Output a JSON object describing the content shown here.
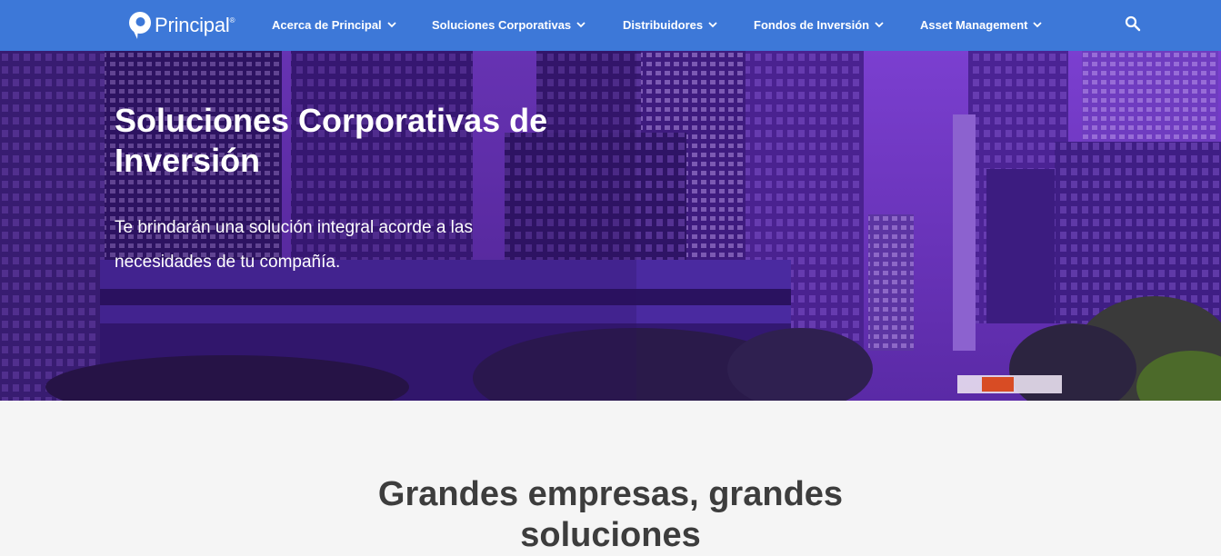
{
  "header": {
    "brand": "Principal",
    "brand_mark": "®",
    "nav": [
      {
        "label": "Acerca de Principal"
      },
      {
        "label": "Soluciones Corporativas"
      },
      {
        "label": "Distribuidores"
      },
      {
        "label": "Fondos de Inversión"
      },
      {
        "label": "Asset Management"
      }
    ],
    "search_icon": "search-icon"
  },
  "hero": {
    "title": "Soluciones Corporativas de Inversión",
    "subtitle": "Te brindarán una solución integral acorde a las necesidades de tu compañía."
  },
  "section": {
    "title": "Grandes empresas, grandes soluciones"
  },
  "colors": {
    "nav_bg": "#3d78d8",
    "hero_tint": "#5b2a9e",
    "page_bg": "#f5f5f5",
    "heading_text": "#3d3d3d"
  }
}
